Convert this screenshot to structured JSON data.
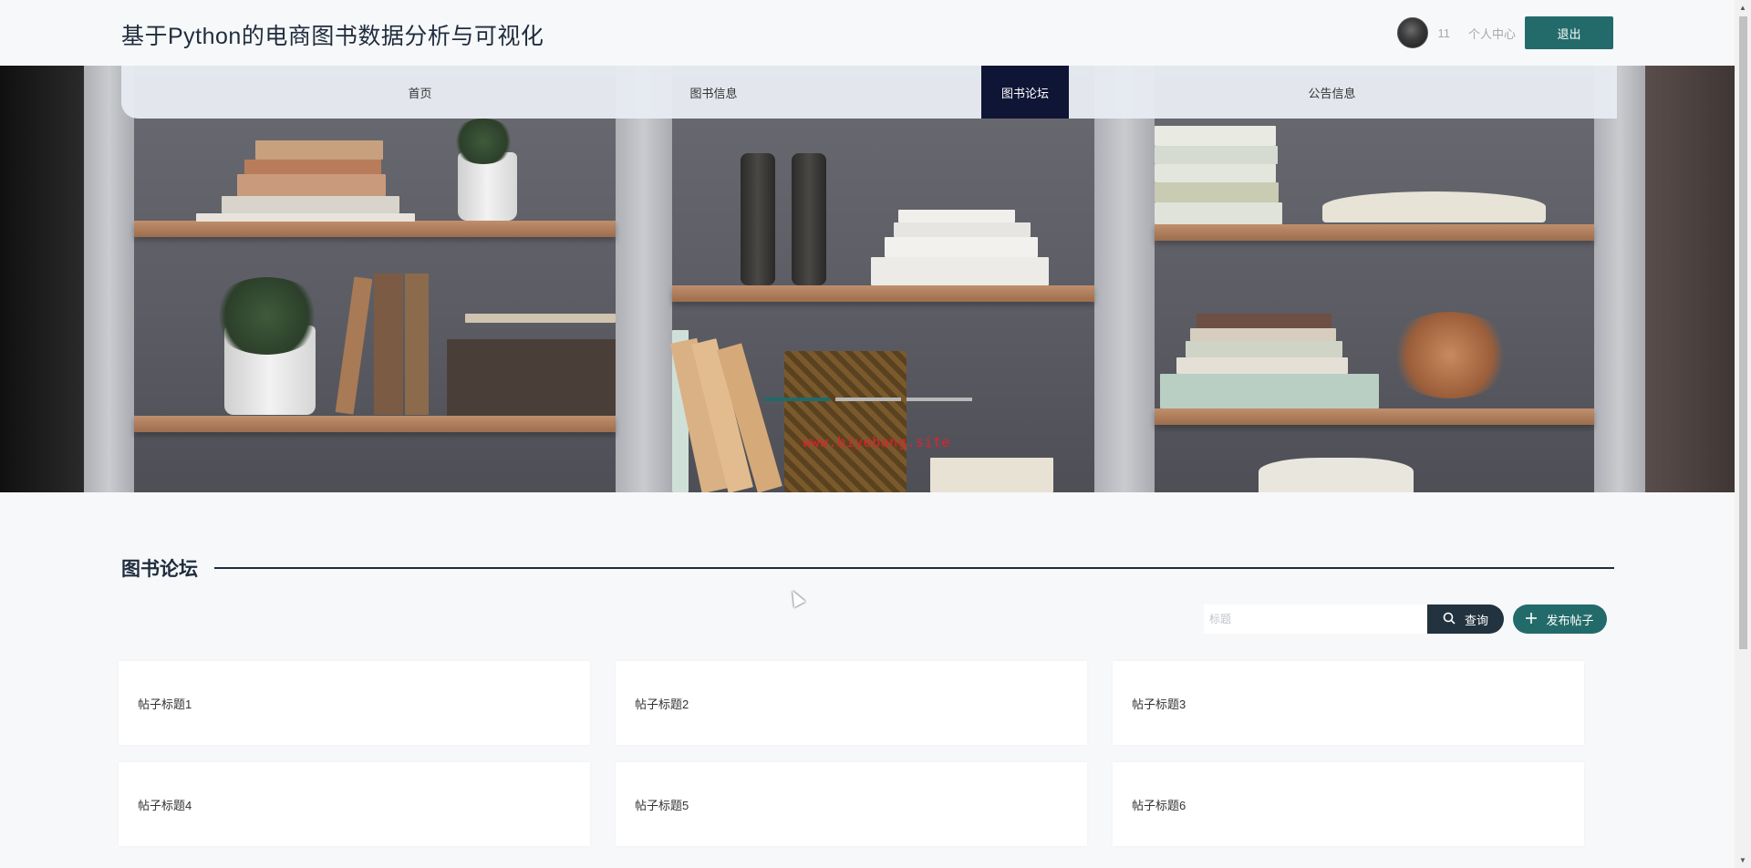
{
  "header": {
    "site_title": "基于Python的电商图书数据分析与可视化",
    "username": "11",
    "profile_link": "个人中心",
    "logout_label": "退出"
  },
  "nav": {
    "items": [
      {
        "label": "首页"
      },
      {
        "label": "图书信息"
      },
      {
        "label": "图书论坛",
        "active": true
      },
      {
        "label": "公告信息"
      }
    ]
  },
  "banner": {
    "watermark": "www.biyebang.site",
    "slides_count": 3,
    "active_slide": 1
  },
  "section": {
    "title": "图书论坛"
  },
  "search": {
    "placeholder": "标题",
    "search_label": "查询",
    "add_label": "发布帖子",
    "search_icon": "search-icon",
    "add_icon": "plus-icon"
  },
  "posts": [
    {
      "title": "帖子标题1"
    },
    {
      "title": "帖子标题2"
    },
    {
      "title": "帖子标题3"
    },
    {
      "title": "帖子标题4"
    },
    {
      "title": "帖子标题5"
    },
    {
      "title": "帖子标题6"
    }
  ],
  "colors": {
    "accent": "#236b6b",
    "nav_active": "#0f1535",
    "dark": "#1f2d3d"
  }
}
